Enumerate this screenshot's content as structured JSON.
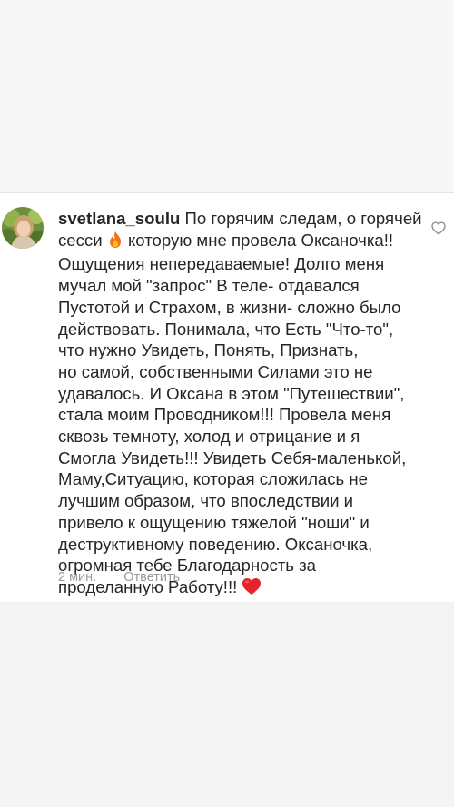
{
  "comment": {
    "username": "svetlana_soulu",
    "first_line_text": "По горячим следам, о горячей",
    "second_line_before_emoji": "сесси",
    "second_line_after_emoji": "которую мне провела Оксаночка!!",
    "lines": [
      "Ощущения непередаваемые! Долго меня",
      "мучал  мой \"запрос\" В теле- отдавался",
      "Пустотой и Страхом, в жизни- сложно было",
      "действовать. Понимала, что Есть \"Что-то\",",
      "что нужно Увидеть, Понять, Признать,",
      "но самой, собственными Силами это не",
      "удавалось. И Оксана в этом \"Путешествии\",",
      "стала моим Проводником!!! Провела меня",
      "сквозь темноту, холод и отрицание и я",
      "Смогла Увидеть!!! Увидеть Себя-маленькой,",
      "Маму,Ситуацию, которая сложилась не",
      "лучшим образом, что впоследствии  и",
      "привело к ощущению тяжелой \"ноши\" и",
      "деструктивному поведению. Оксаночка,",
      "огромная тебе Благодарность за"
    ],
    "last_line_text": "проделанную Работу!!!",
    "emojis": [
      "fire-emoji",
      "red-heart-emoji"
    ],
    "time": "2 мин.",
    "reply_label": "Ответить"
  },
  "icons": {
    "like": "heart-outline-icon",
    "avatar": "user-avatar"
  },
  "colors": {
    "text": "#262626",
    "meta": "#9a9a9a",
    "heart_red": "#e8222a",
    "fire_orange": "#f36f1c"
  }
}
